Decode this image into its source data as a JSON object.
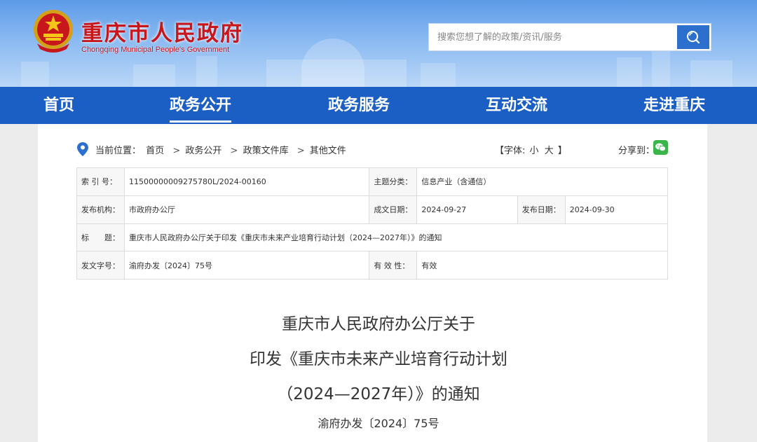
{
  "header": {
    "site_title": "重庆市人民政府",
    "site_subtitle": "Chongqing Municipal People's Government",
    "search_placeholder": "搜索您想了解的政策/资讯/服务"
  },
  "nav": {
    "items": [
      {
        "label": "首页"
      },
      {
        "label": "政务公开",
        "active": true
      },
      {
        "label": "政务服务"
      },
      {
        "label": "互动交流"
      },
      {
        "label": "走进重庆"
      }
    ]
  },
  "location": {
    "label": "当前位置：",
    "crumbs": [
      "首页",
      "政务公开",
      "政策文件库",
      "其他文件"
    ],
    "separator": ">"
  },
  "font_size": {
    "prefix": "【字体:",
    "small": "小",
    "large": "大",
    "suffix": "】"
  },
  "share": {
    "label": "分享到："
  },
  "meta": {
    "index_label": "索 引 号：",
    "index_value": "11500000009275780L/2024-00160",
    "topic_label": "主题分类：",
    "topic_value": "信息产业（含通信）",
    "issuer_label": "发布机构：",
    "issuer_value": "市政府办公厅",
    "created_label": "成文日期：",
    "created_value": "2024-09-27",
    "published_label": "发布日期：",
    "published_value": "2024-09-30",
    "title_label": "标　　题：",
    "title_value": "重庆市人民政府办公厅关于印发《重庆市未来产业培育行动计划（2024—2027年）》的通知",
    "docno_label": "发文字号：",
    "docno_value": "渝府办发〔2024〕75号",
    "validity_label": "有 效 性：",
    "validity_value": "有效"
  },
  "article": {
    "title_line1": "重庆市人民政府办公厅关于",
    "title_line2": "印发《重庆市未来产业培育行动计划",
    "title_line3": "（2024—2027年）》的通知",
    "doc_number": "渝府办发〔2024〕75号"
  },
  "colors": {
    "nav_bg": "#1c5fc4",
    "title_red": "#c8161d",
    "search_button": "#2c6fcd",
    "wechat_green": "#39b54a"
  }
}
